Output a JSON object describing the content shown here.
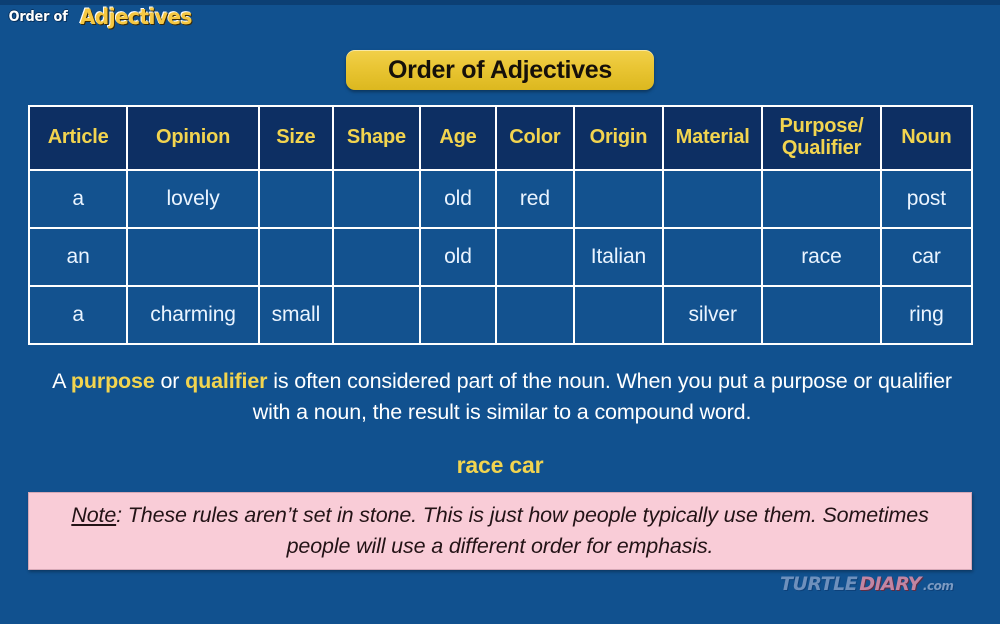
{
  "logo": {
    "prefix": "Order of",
    "main": "Adjectives"
  },
  "title": {
    "text": "Order of Adjectives"
  },
  "table": {
    "headers": [
      "Article",
      "Opinion",
      "Size",
      "Shape",
      "Age",
      "Color",
      "Origin",
      "Material",
      "Purpose/ Qualifier",
      "Noun"
    ],
    "header_purpose_line1": "Purpose/",
    "header_purpose_line2": "Qualifier",
    "rows": [
      {
        "article": "a",
        "opinion": "lovely",
        "size": "",
        "shape": "",
        "age": "old",
        "color": "red",
        "origin": "",
        "material": "",
        "purpose": "",
        "noun": "post"
      },
      {
        "article": "an",
        "opinion": "",
        "size": "",
        "shape": "",
        "age": "old",
        "color": "",
        "origin": "Italian",
        "material": "",
        "purpose": "race",
        "noun": "car"
      },
      {
        "article": "a",
        "opinion": "charming",
        "size": "small",
        "shape": "",
        "age": "",
        "color": "",
        "origin": "",
        "material": "silver",
        "purpose": "",
        "noun": "ring"
      }
    ]
  },
  "paragraph": {
    "part1": "A ",
    "bold1": "purpose",
    "part2": " or ",
    "bold2": "qualifier",
    "part3": " is often considered part of the noun. When you put a purpose or qualifier with a noun, the result is similar to a compound word."
  },
  "example": {
    "text": "race car"
  },
  "note": {
    "label": "Note",
    "body": ": These rules aren’t set in stone. This is just how people typically use them. Sometimes people will use a different order for emphasis."
  },
  "watermark": {
    "turtle": "TURTLE",
    "diary": "DIARY",
    "com": ".com"
  },
  "colors": {
    "background": "#11518f",
    "header_cell": "#0d2f63",
    "body_cell": "#13528f",
    "accent_yellow": "#f2d44f",
    "title_banner": "#e8c431",
    "note_pink": "#f9ccd7",
    "border_white": "#ffffff"
  }
}
